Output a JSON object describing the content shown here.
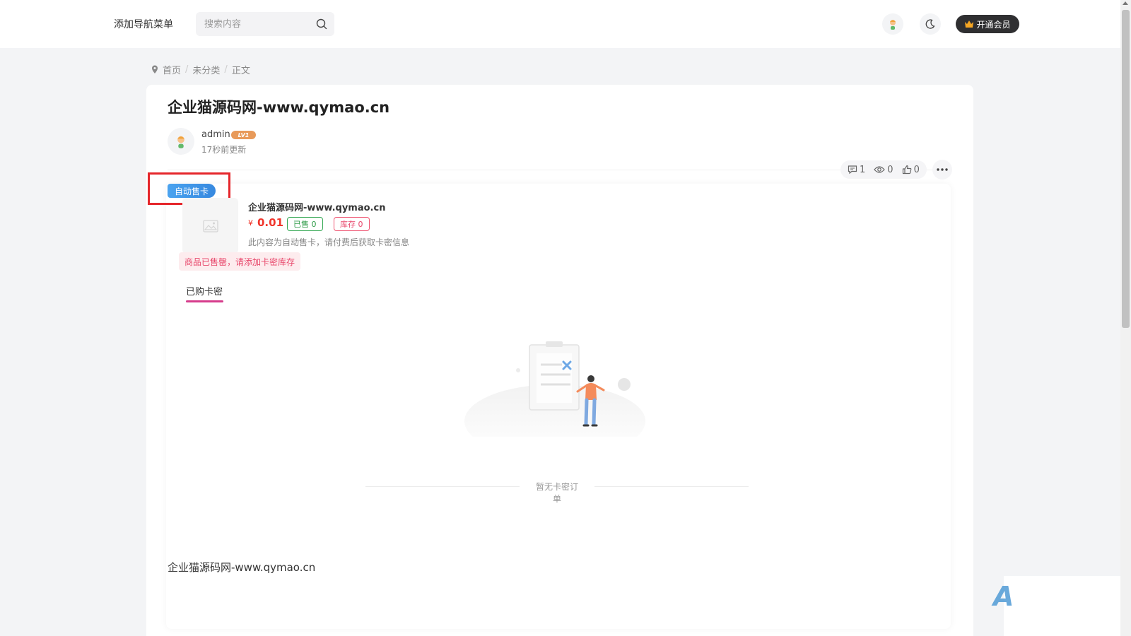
{
  "header": {
    "nav_menu_label": "添加导航菜单",
    "search_placeholder": "搜索内容",
    "vip_label": "开通会员"
  },
  "breadcrumb": {
    "items": [
      "首页",
      "未分类",
      "正文"
    ],
    "separator": "/"
  },
  "post": {
    "title": "企业猫源码网-www.qymao.cn",
    "author": "admin",
    "level_badge": "LV1",
    "updated": "17秒前更新",
    "stats": {
      "comments": "1",
      "views": "0",
      "likes": "0"
    },
    "body_text": "企业猫源码网-www.qymao.cn"
  },
  "product": {
    "tag": "自动售卡",
    "name": "企业猫源码网-www.qymao.cn",
    "currency": "¥",
    "price": "0.01",
    "sold_badge": "已售 0",
    "stock_badge": "库存 0",
    "description": "此内容为自动售卡，请付费后获取卡密信息",
    "soldout_notice": "商品已售罄，请添加卡密库存",
    "tab_label": "已购卡密",
    "empty_text": "暂无卡密订单"
  },
  "colors": {
    "accent_red": "#f0362c",
    "highlight_box": "#e5262b",
    "tag_blue": "#3688df",
    "tab_underline": "#d63d8c",
    "sold_green": "#2d9a47",
    "stock_pink": "#e8466a"
  },
  "icons": {
    "location": "location-pin-icon",
    "search": "search-icon",
    "avatar": "avatar-icon",
    "theme": "moon-icon",
    "crown": "crown-icon",
    "comment": "comment-icon",
    "view": "eye-icon",
    "like": "thumbs-up-icon",
    "more": "more-dots-icon",
    "image_placeholder": "image-placeholder-icon"
  }
}
